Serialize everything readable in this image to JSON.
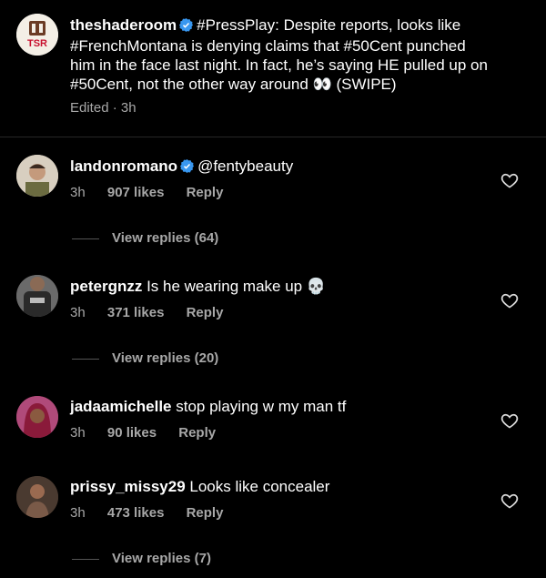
{
  "caption": {
    "username": "theshaderoom",
    "text_line1": "#PressPlay: Despite reports, looks like",
    "text_line2": "#FrenchMontana is denying claims that #50Cent punched",
    "text_line3": "him in the face last night. In fact, he’s saying HE pulled up on",
    "text_line4": "#50Cent, not the other way around",
    "emoji": "👀",
    "text_line4_end": "(SWIPE)",
    "edited": "Edited",
    "time": "3h",
    "logo_text": "TSR"
  },
  "comments": [
    {
      "username": "landonromano",
      "verified": true,
      "text": "@fentybeauty",
      "time": "3h",
      "likes": "907 likes",
      "reply": "Reply",
      "view_replies": "View replies (64)"
    },
    {
      "username": "petergnzz",
      "verified": false,
      "text": "Is he wearing make up",
      "emoji": "💀",
      "time": "3h",
      "likes": "371 likes",
      "reply": "Reply",
      "view_replies": "View replies (20)"
    },
    {
      "username": "jadaamichelle",
      "verified": false,
      "text": "stop playing w my man tf",
      "time": "3h",
      "likes": "90 likes",
      "reply": "Reply"
    },
    {
      "username": "prissy_missy29",
      "verified": false,
      "text": "Looks like concealer",
      "time": "3h",
      "likes": "473 likes",
      "reply": "Reply",
      "view_replies": "View replies (7)"
    }
  ],
  "colors": {
    "background": "#000000",
    "muted_text": "#a8a8a8",
    "verified_blue": "#3897f0"
  }
}
